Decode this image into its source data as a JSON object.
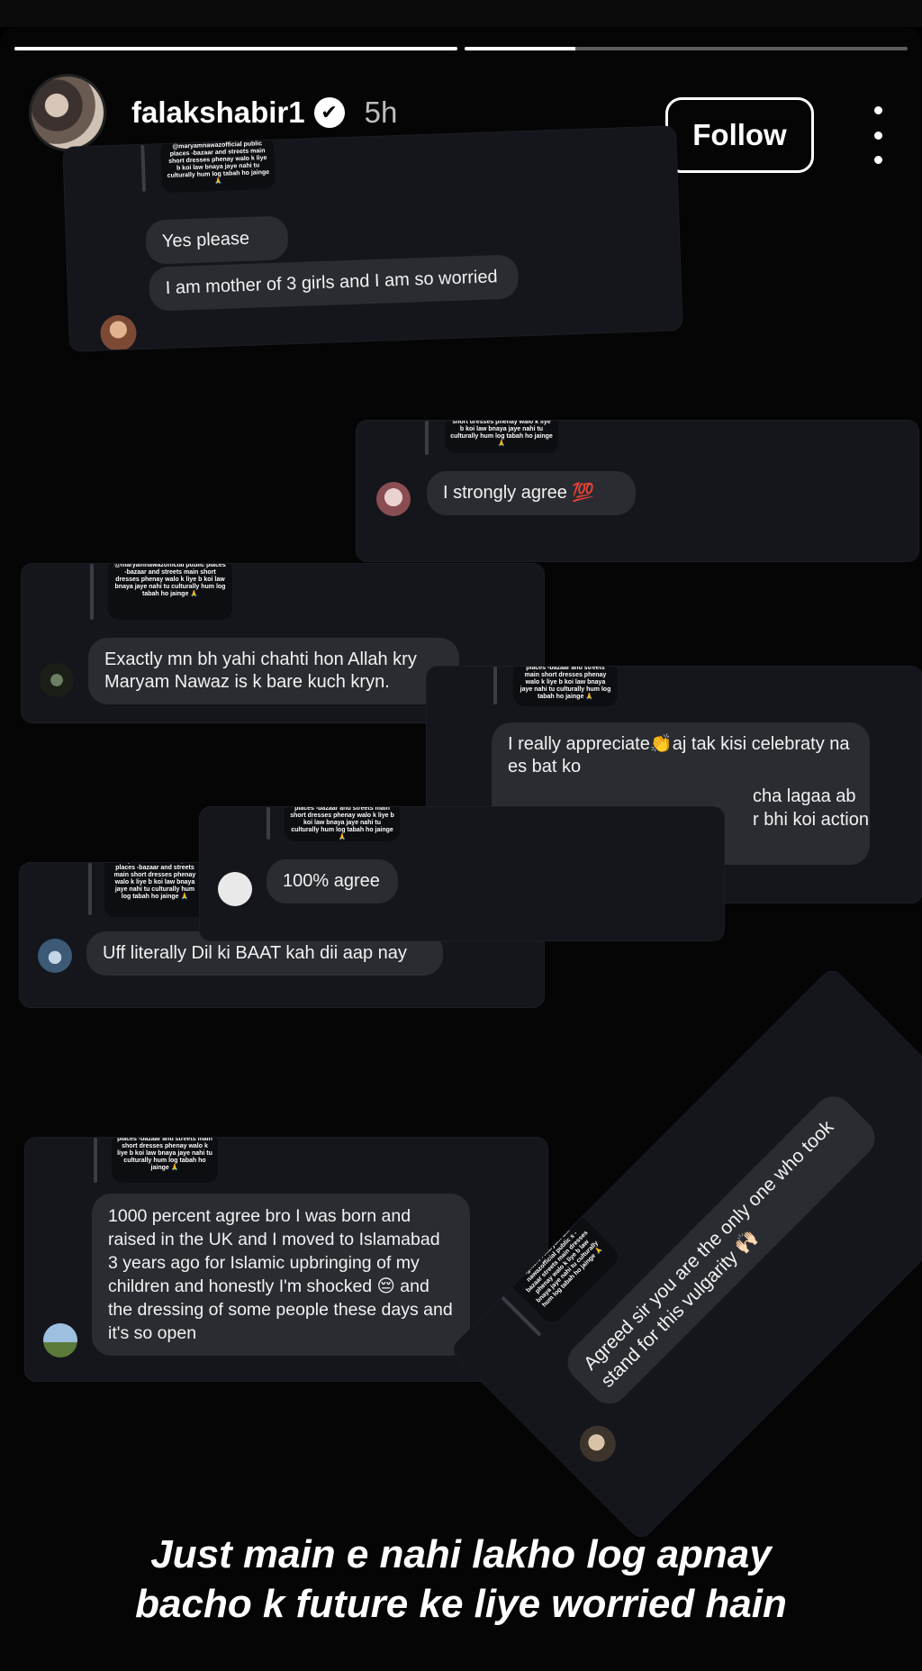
{
  "story": {
    "username": "falakshabir1",
    "verified_icon": "✔",
    "time": "5h",
    "follow_label": "Follow",
    "progress": [
      1.0,
      0.25
    ]
  },
  "quotes": {
    "q1": "@maryamnawazofficial public places -bazaar and streets main short dresses phenay walo k liye b koi law bnaya jaye nahi tu culturally hum log tabah ho jainge 🙏",
    "q2": "short dresses phenay walo k liye b koi law bnaya jaye nahi tu culturally hum log tabah ho jainge 🙏",
    "q3": "@maryamnawazofficial public places -bazaar and streets main short dresses phenay walo k liye b koi law bnaya jaye nahi tu culturally hum log tabah ho jainge 🙏",
    "q4": "places -bazaar and streets main short dresses phenay walo k liye b koi law bnaya jaye nahi tu culturally hum log tabah ho jainge 🙏",
    "q5": "places -bazaar and streets main short dresses phenay walo k liye b koi law bnaya jaye nahi tu culturally hum log tabah ho jainge 🙏",
    "q6": "@maryamnawazofficial public places -bazaar and streets main short dresses phenay walo k liye b koi law bnaya jaye nahi tu culturally hum log tabah ho jainge 🙏",
    "q7": "places -bazaar and streets main short dresses phenay walo k liye b koi law bnaya jaye nahi tu culturally hum log tabah ho jainge 🙏",
    "q8": "ighters l maryam CM nawazofficial public s -bazaar streets main dresses phenay walo k liye b law bnaya jaye nahi tu culturally hum log tabah ho jainge 🙏"
  },
  "comments": {
    "c1a": "Yes please",
    "c1b": "I am mother of 3 girls and I am so worried",
    "c2": "I strongly agree 💯",
    "c3": "Exactly mn bh yahi chahti hon Allah kry Maryam Nawaz is k bare kuch kryn.",
    "c4a": "I really appreciate👏aj tak kisi celebraty na es bat ko",
    "c4b": "cha lagaa ab",
    "c4c": "r bhi koi action",
    "c5": "100% agree",
    "c6": "Uff literally Dil ki BAAT kah dii aap nay",
    "c7": "1000 percent agree bro I was born and raised in the UK and I moved to Islamabad 3 years ago for Islamic upbringing of my children and honestly I'm shocked 😔 and the dressing of some people these days and it's so open",
    "c8": "Agreed sir you are the only one who took stand for this vulgarity 🙌🏻"
  },
  "caption": {
    "line1": "Just main e nahi lakho log apnay",
    "line2": "bacho k future ke liye worried hain"
  }
}
